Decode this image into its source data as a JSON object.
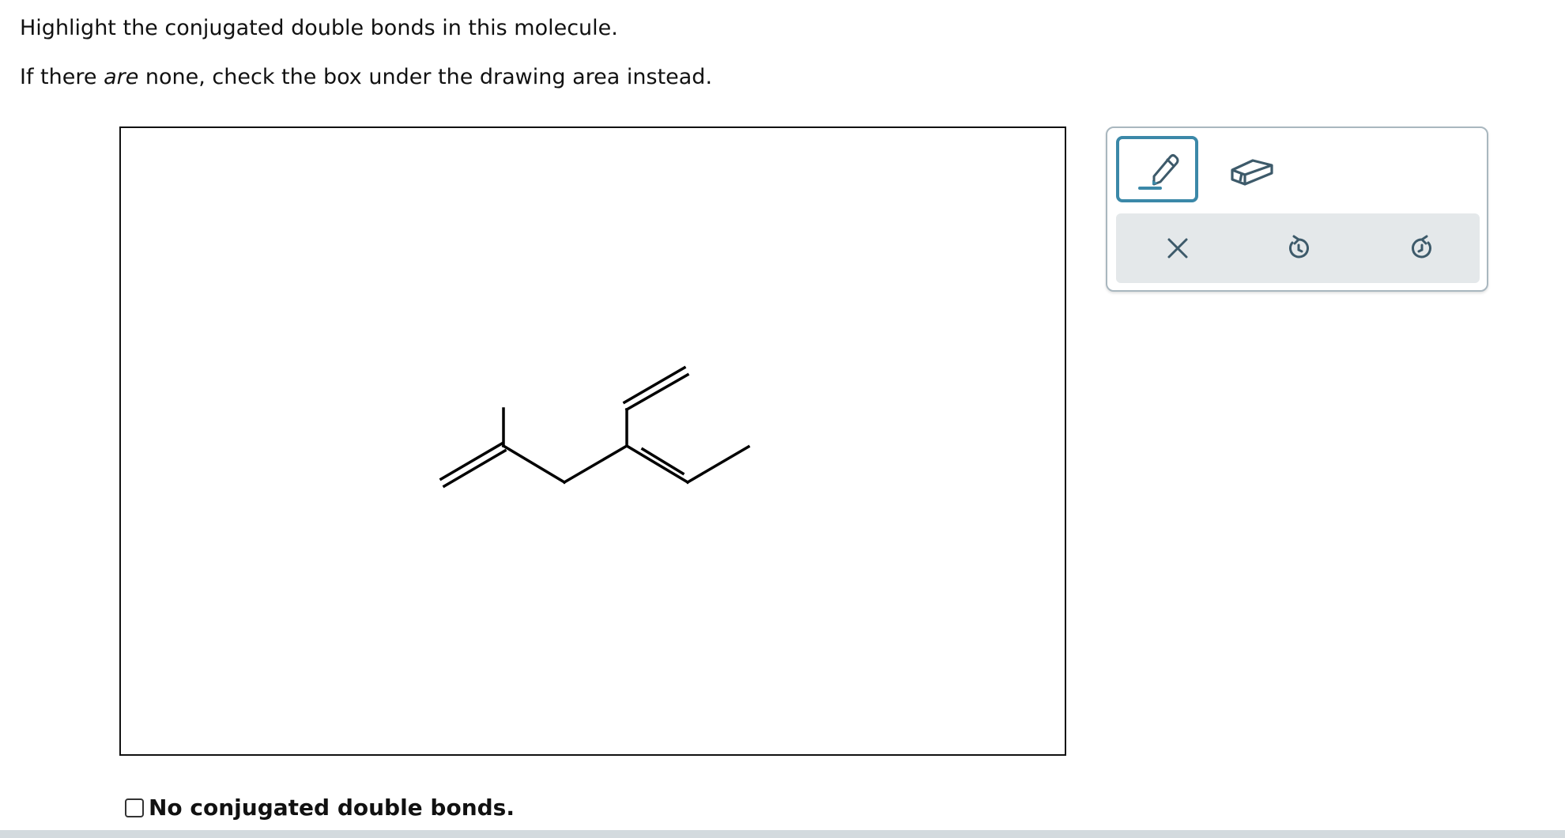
{
  "instructions": {
    "line1": "Highlight the conjugated double bonds in this molecule.",
    "line2_before": "If there ",
    "line2_emphasis": "are",
    "line2_after": " none, check the box under the drawing area instead."
  },
  "molecule": {
    "structure": "skeletal formula: isoprenyl-type diene — CH2=C(CH3)-CH2-C(CH=CH2)=CH-CH3",
    "bonds": [
      {
        "order": 2
      },
      {
        "order": 1
      },
      {
        "order": 1
      },
      {
        "order": 1
      },
      {
        "order": 1
      },
      {
        "order": 2
      },
      {
        "order": 2
      },
      {
        "order": 1
      }
    ]
  },
  "toolbox": {
    "tools": [
      {
        "name": "pencil-icon",
        "selected": true
      },
      {
        "name": "eraser-icon",
        "selected": false
      }
    ],
    "actions": [
      "close-icon",
      "undo-icon",
      "redo-icon"
    ],
    "accent_color": "#3b88a8",
    "icon_color": "#3d5a6a"
  },
  "no_conjugation": {
    "label": "No conjugated double bonds.",
    "checked": false
  }
}
